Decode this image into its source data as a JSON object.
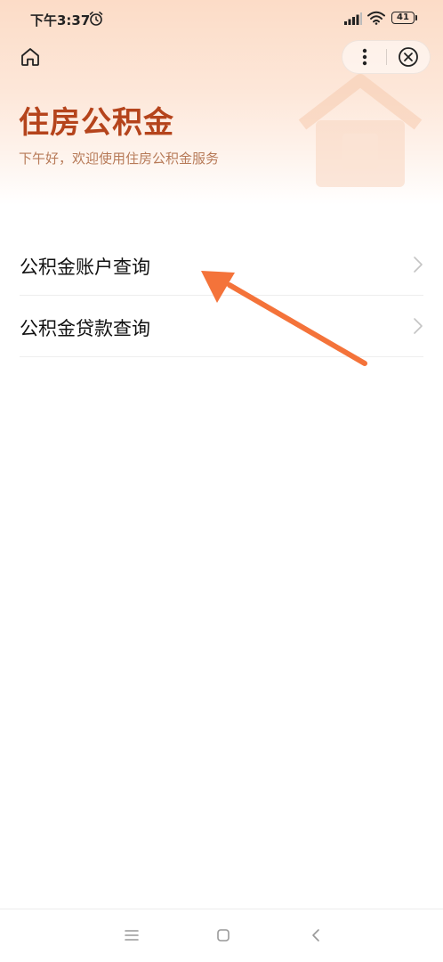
{
  "status_bar": {
    "time": "下午3:37",
    "battery": "41"
  },
  "header": {
    "title": "住房公积金",
    "subtitle": "下午好，欢迎使用住房公积金服务"
  },
  "menu": {
    "items": [
      {
        "label": "公积金账户查询"
      },
      {
        "label": "公积金贷款查询"
      }
    ]
  },
  "icons": {
    "home": "home-icon",
    "more": "more-dots-icon",
    "close": "close-circle-icon",
    "chevron": "chevron-right-icon",
    "nav_menu": "menu-lines-icon",
    "nav_home": "square-icon",
    "nav_back": "back-chevron-icon"
  },
  "colors": {
    "title": "#b5441c",
    "subtitle": "#b77a58",
    "arrow": "#f4733a",
    "header_bg": "#fcdcc7"
  }
}
